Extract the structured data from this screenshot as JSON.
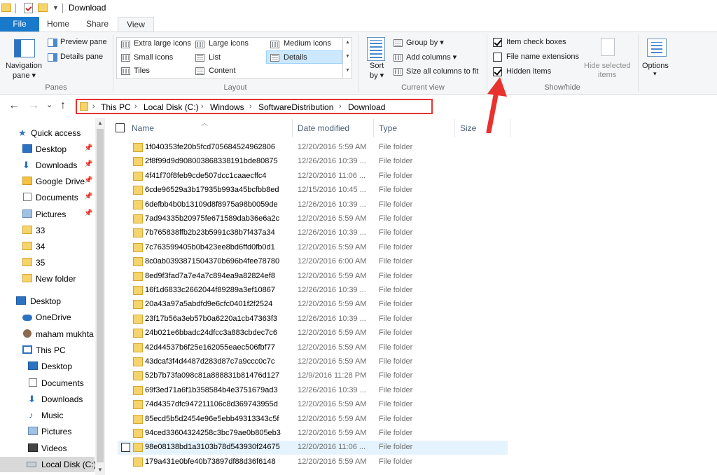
{
  "window": {
    "title": "Download"
  },
  "tabs": {
    "file": "File",
    "home": "Home",
    "share": "Share",
    "view": "View"
  },
  "ribbon": {
    "panes": {
      "navigation_pane_line1": "Navigation",
      "navigation_pane_line2": "pane ▾",
      "preview_pane": "Preview pane",
      "details_pane": "Details pane",
      "label": "Panes"
    },
    "layout": {
      "extra_large": "Extra large icons",
      "large": "Large icons",
      "medium": "Medium icons",
      "small": "Small icons",
      "list": "List",
      "details": "Details",
      "tiles": "Tiles",
      "content": "Content",
      "label": "Layout"
    },
    "current_view": {
      "sort_line1": "Sort",
      "sort_line2": "by ▾",
      "group_by": "Group by ▾",
      "add_columns": "Add columns ▾",
      "size_all": "Size all columns to fit",
      "label": "Current view"
    },
    "show_hide": {
      "item_check_boxes": "Item check boxes",
      "item_check_boxes_checked": true,
      "file_name_extensions": "File name extensions",
      "file_name_extensions_checked": false,
      "hidden_items": "Hidden items",
      "hidden_items_checked": true,
      "hide_selected_line1": "Hide selected",
      "hide_selected_line2": "items",
      "label": "Show/hide"
    },
    "options": {
      "label": "Options",
      "arrow": "▾"
    }
  },
  "address": {
    "crumbs": [
      "This PC",
      "Local Disk (C:)",
      "Windows",
      "SoftwareDistribution",
      "Download"
    ],
    "separator": "›"
  },
  "nav_buttons": {
    "back": "←",
    "forward": "→",
    "recent": "⌄",
    "up": "↑"
  },
  "navpane": {
    "items": [
      {
        "label": "Quick access",
        "icon": "star-icon"
      },
      {
        "label": "Desktop",
        "icon": "desktop-icon"
      },
      {
        "label": "Downloads",
        "icon": "download-arrow-icon"
      },
      {
        "label": "Google Drive",
        "icon": "google-drive-icon"
      },
      {
        "label": "Documents",
        "icon": "documents-icon"
      },
      {
        "label": "Pictures",
        "icon": "pictures-icon"
      },
      {
        "label": "33",
        "icon": "folder-icon"
      },
      {
        "label": "34",
        "icon": "folder-icon"
      },
      {
        "label": "35",
        "icon": "folder-icon"
      },
      {
        "label": "New folder",
        "icon": "folder-icon"
      },
      {
        "label": "Desktop",
        "icon": "desktop-icon"
      },
      {
        "label": "OneDrive",
        "icon": "onedrive-cloud-icon"
      },
      {
        "label": "maham mukhta",
        "icon": "user-icon"
      },
      {
        "label": "This PC",
        "icon": "this-pc-icon"
      },
      {
        "label": "Desktop",
        "icon": "desktop-icon"
      },
      {
        "label": "Documents",
        "icon": "documents-icon"
      },
      {
        "label": "Downloads",
        "icon": "download-arrow-icon"
      },
      {
        "label": "Music",
        "icon": "music-note-icon"
      },
      {
        "label": "Pictures",
        "icon": "pictures-icon"
      },
      {
        "label": "Videos",
        "icon": "videos-icon"
      },
      {
        "label": "Local Disk (C:)",
        "icon": "local-disk-icon"
      }
    ]
  },
  "columns": {
    "name": "Name",
    "date_modified": "Date modified",
    "type": "Type",
    "size": "Size"
  },
  "files": [
    {
      "name": "1f040353fe20b5fcd705684524962806",
      "date": "12/20/2016 5:59 AM",
      "type": "File folder"
    },
    {
      "name": "2f8f99d9d908003868338191bde80875",
      "date": "12/26/2016 10:39 ...",
      "type": "File folder"
    },
    {
      "name": "4f41f70f8feb9cde507dcc1caaecffc4",
      "date": "12/20/2016 11:06 ...",
      "type": "File folder"
    },
    {
      "name": "6cde96529a3b17935b993a45bcfbb8ed",
      "date": "12/15/2016 10:45 ...",
      "type": "File folder"
    },
    {
      "name": "6defbb4b0b13109d8f8975a98b0059de",
      "date": "12/26/2016 10:39 ...",
      "type": "File folder"
    },
    {
      "name": "7ad94335b20975fe671589dab36e6a2c",
      "date": "12/20/2016 5:59 AM",
      "type": "File folder"
    },
    {
      "name": "7b765838ffb2b23b5991c38b7f437a34",
      "date": "12/26/2016 10:39 ...",
      "type": "File folder"
    },
    {
      "name": "7c763599405b0b423ee8bd6ffd0fb0d1",
      "date": "12/20/2016 5:59 AM",
      "type": "File folder"
    },
    {
      "name": "8c0ab0393871504370b696b4fee78780",
      "date": "12/20/2016 6:00 AM",
      "type": "File folder"
    },
    {
      "name": "8ed9f3fad7a7e4a7c894ea9a82824ef8",
      "date": "12/20/2016 5:59 AM",
      "type": "File folder"
    },
    {
      "name": "16f1d6833c2662044f89289a3ef10867",
      "date": "12/26/2016 10:39 ...",
      "type": "File folder"
    },
    {
      "name": "20a43a97a5abdfd9e6cfc0401f2f2524",
      "date": "12/20/2016 5:59 AM",
      "type": "File folder"
    },
    {
      "name": "23f17b56a3eb57b0a6220a1cb47363f3",
      "date": "12/26/2016 10:39 ...",
      "type": "File folder"
    },
    {
      "name": "24b021e6bbadc24dfcc3a883cbdec7c6",
      "date": "12/20/2016 5:59 AM",
      "type": "File folder"
    },
    {
      "name": "42d44537b6f25e162055eaec506fbf77",
      "date": "12/20/2016 5:59 AM",
      "type": "File folder"
    },
    {
      "name": "43dcaf3f4d4487d283d87c7a9ccc0c7c",
      "date": "12/20/2016 5:59 AM",
      "type": "File folder"
    },
    {
      "name": "52b7b73fa098c81a888831b81476d127",
      "date": "12/9/2016 11:28 PM",
      "type": "File folder"
    },
    {
      "name": "69f3ed71a6f1b358584b4e3751679ad3",
      "date": "12/26/2016 10:39 ...",
      "type": "File folder"
    },
    {
      "name": "74d4357dfc947211106c8d369743955d",
      "date": "12/20/2016 5:59 AM",
      "type": "File folder"
    },
    {
      "name": "85ecd5b5d2454e96e5ebb49313343c5f",
      "date": "12/20/2016 5:59 AM",
      "type": "File folder"
    },
    {
      "name": "94ced33604324258c3bc79ae0b805eb3",
      "date": "12/20/2016 5:59 AM",
      "type": "File folder"
    },
    {
      "name": "98e08138bd1a3103b78d543930f24675",
      "date": "12/20/2016 11:06 ...",
      "type": "File folder"
    },
    {
      "name": "179a431e0bfe40b73897df88d36f6148",
      "date": "12/20/2016 5:59 AM",
      "type": "File folder"
    }
  ],
  "colors": {
    "file_tab": "#1979ca",
    "highlight": "#e8322e",
    "folder": "#f6d36b",
    "hover_row": "#e5f3ff"
  }
}
